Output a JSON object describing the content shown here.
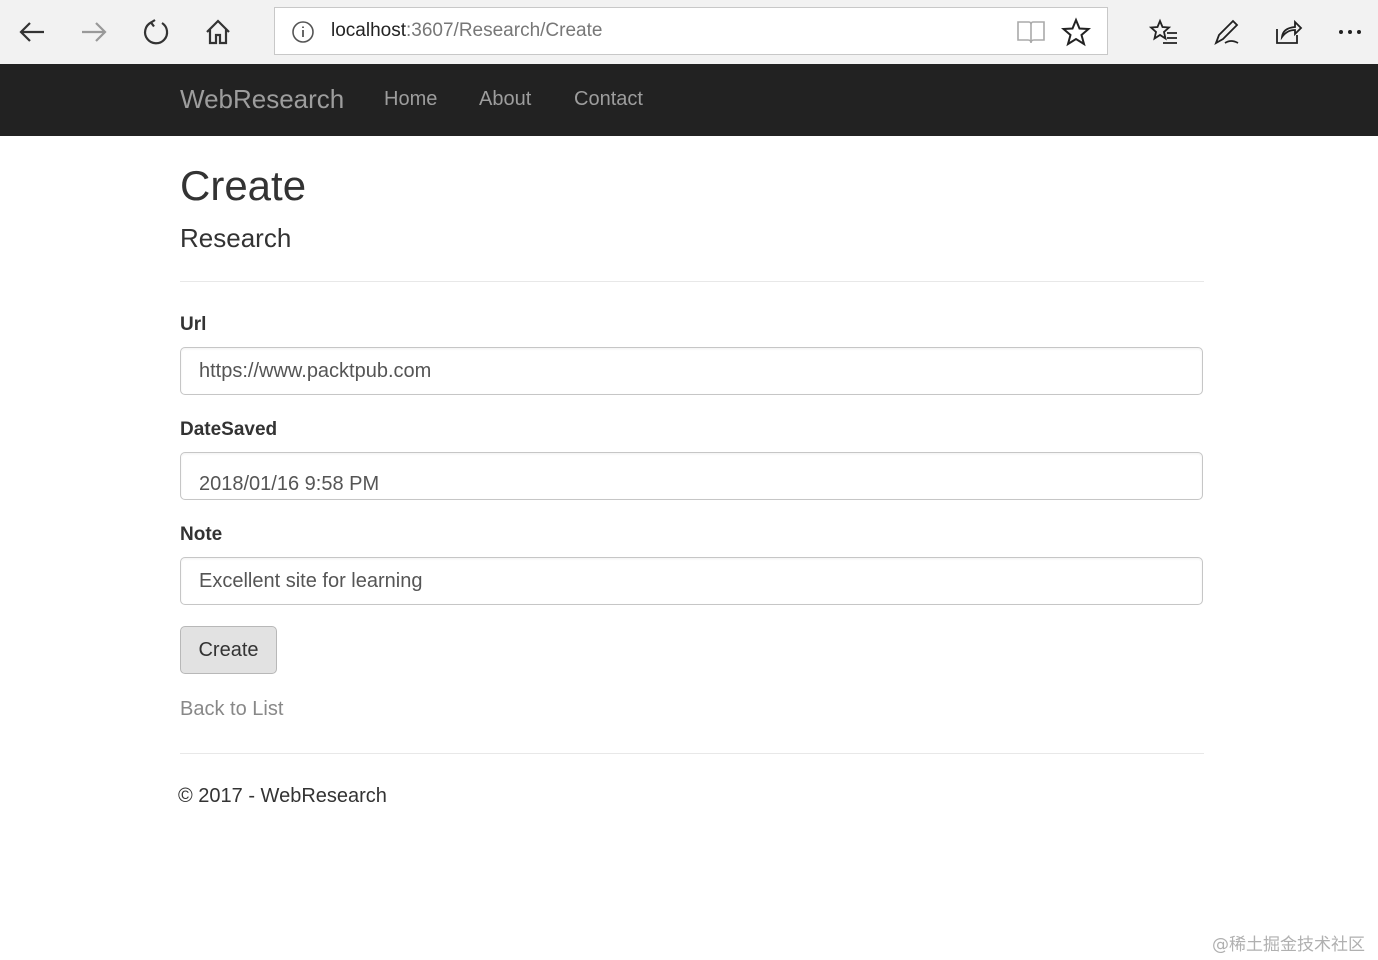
{
  "browser": {
    "url_host": "localhost",
    "url_path": ":3607/Research/Create"
  },
  "navbar": {
    "brand": "WebResearch",
    "links": [
      "Home",
      "About",
      "Contact"
    ]
  },
  "page": {
    "title": "Create",
    "subtitle": "Research"
  },
  "form": {
    "fields": [
      {
        "label": "Url",
        "value": "https://www.packtpub.com"
      },
      {
        "label": "DateSaved",
        "value": "2018/01/16 9:58 PM"
      },
      {
        "label": "Note",
        "value": "Excellent site for learning"
      }
    ],
    "submit_label": "Create"
  },
  "back_link": "Back to List",
  "footer": "© 2017 - WebResearch",
  "watermark": "@稀土掘金技术社区"
}
